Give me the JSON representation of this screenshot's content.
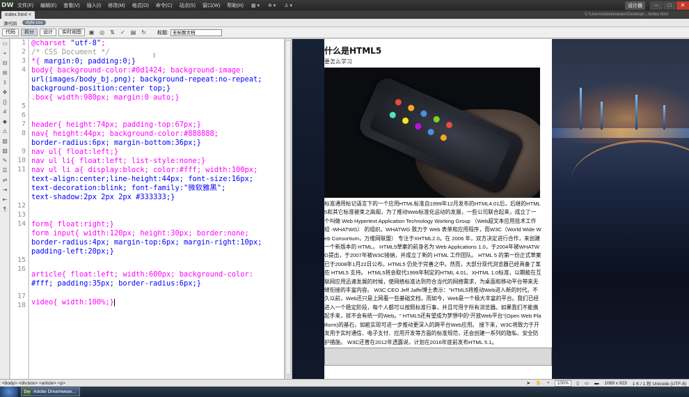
{
  "app": {
    "logo": "DW",
    "menus": [
      "文件(F)",
      "编辑(E)",
      "查看(V)",
      "插入(I)",
      "修改(M)",
      "格式(O)",
      "命令(C)",
      "站点(S)",
      "窗口(W)",
      "帮助(H)"
    ],
    "layout_selector": "设计器",
    "window_buttons": [
      "–",
      "□",
      "✕"
    ]
  },
  "doc_tab": {
    "name": "index.html",
    "close": "×",
    "path": "C:\\Users\\Administrator\\Desktop\\...\\index.html"
  },
  "related_files": [
    "源代码",
    "style.css"
  ],
  "toolbar": {
    "views": [
      "代码",
      "拆分",
      "设计",
      "实时视图"
    ],
    "title_label": "标题:",
    "title_value": "无标题文档"
  },
  "code_lines": [
    "1",
    "2",
    "3",
    "4",
    "5",
    "6",
    "7",
    "8",
    "9",
    "10",
    "11",
    "12",
    "13",
    "14",
    "15",
    "16",
    "17",
    "18"
  ],
  "code": {
    "l1a": "@charset ",
    "l1b": "\"utf-8\"",
    "l1c": ";",
    "l2": "/* CSS Document */",
    "l3a": "*{ ",
    "l3b": "margin",
    "l3c": ":0; ",
    "l3d": "padding",
    "l3e": ":0;}",
    "l4": "body{ background-color:#0d1424; background-image:",
    "l4b": "url(images/body_bj.png); background-repeat:no-repeat;",
    "l4c": "background-position:center top;}",
    "l5": ".box{ width:980px; margin:0 auto;}",
    "l7": "header{ height:74px; padding-top:67px;}",
    "l8": "nav{ height:44px; background-color:#888888;",
    "l8b": "border-radius:6px; margin-bottom:36px;}",
    "l9": "nav ul{ float:left;}",
    "l10": "nav ul li{ float:left; list-style:none;}",
    "l11": "nav ul li a{ display:block; color:#fff; width:100px;",
    "l11b": "text-align:center;line-height:44px; font-size:16px;",
    "l11c": "text-decoration:blink; font-family:\"微软雅黑\";",
    "l11d": "text-shadow:2px 2px 2px #333333;}",
    "l13": "form{ float:right;}",
    "l14": "form input{ width:120px; height:30px; border:none;",
    "l14b": "border-radius:4px; margin-top:6px; margin-right:10px;",
    "l14c": "padding-left:20px;}",
    "l16": "article{ float:left; width:600px; background-color:",
    "l16b": "#fff; padding:35px; border-radius:6px;}",
    "l17": "video{ width:100%;}"
  },
  "live": {
    "heading": "什么是HTML5",
    "subheading": "要怎么学习",
    "body": "标准通用标记语言下的一个应用HTML标准自1999年12月发布的HTML4.01后，后继的HTML5和其它标准被束之高阁，为了推动Web标准化运动的发展，一些公司联合起来，成立了一个叫做 Web Hypertext Application Technology Working Group （Web超文本应用技术工作组 -WHATWG） 的组织。WHATWG 致力于 Web 表单和应用程序，而W3C（World Wide Web Consortium，万维网联盟） 专注于XHTML2.0。在 2006 年，双方决定进行合作，来创建一个新版本的 HTML。 HTML5草案的前身名为 Web Applications 1.0，于2004年被WHATWG提出，于2007年被W3C接纳，并成立了新的 HTML 工作团队。 HTML 5 的第一份正式草案已于2008年1月22日公布。HTML5 仍处于完善之中。然而，大部分现代浏览器已经具备了某些 HTML5 支持。 HTML5将会取代1999年制定的HTML 4.01、XHTML 1.0标准，以期能在互联网应用迅速发展的时候，使网络标准达到符合当代的网络需求，为桌面和移动平台带来无缝衔接的丰富内容。 W3C CEO Jeff Jaffe博士表示：\"HTML5将推动Web进入新的时代。不久以前，Web还只是上网看一些基础文档，而如今，Web是一个极大丰富的平台。我们已经进入一个稳定阶段，每个人都可以按照标准行事，并且可用于所有浏览器。如果我们不能携起手来，就不会有统一的Web。\" HTML5还有望成为梦想中的\"开放Web平台\"(Open Web Platform)的基石，如能实现可进一步推动更深入的跨平台Web应用。 接下来，W3C将致力于开发用于实时通信、电子支付、应用开发等方面的标准规范，还会创建一系列的隐私、安全防护措施。 W3C还曾在2012年透露说，计划在2016年底前发布HTML 5.1。"
  },
  "status": {
    "tags": "<body> <div.box> <article> <p>",
    "zoom": "100%",
    "size": "1089 x 923",
    "info": "1 K / 1 秒  Unicode (UTF-8)"
  },
  "taskbar": {
    "item": "Adobe Dreamweav..."
  },
  "colors": {
    "code_selector": "#ff00ff",
    "code_value": "#0000ff",
    "page_bg": "#0d1424"
  }
}
